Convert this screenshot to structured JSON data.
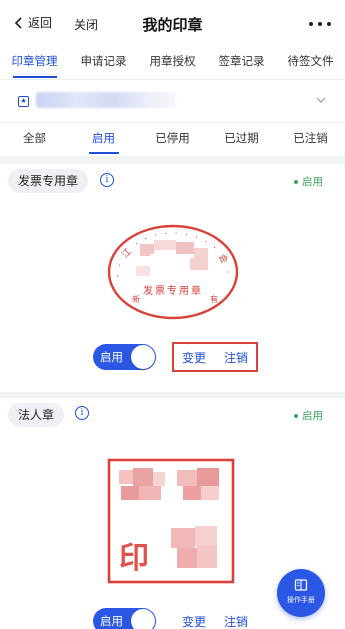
{
  "nav": {
    "back_label": "返回",
    "close_label": "关闭",
    "title": "我的印章"
  },
  "tabs": [
    {
      "label": "印章管理",
      "active": true
    },
    {
      "label": "申请记录",
      "active": false
    },
    {
      "label": "用章授权",
      "active": false
    },
    {
      "label": "签章记录",
      "active": false
    },
    {
      "label": "待签文件",
      "active": false
    }
  ],
  "status_tabs": [
    {
      "label": "全部",
      "active": false
    },
    {
      "label": "启用",
      "active": true
    },
    {
      "label": "已停用",
      "active": false
    },
    {
      "label": "已过期",
      "active": false
    },
    {
      "label": "已注销",
      "active": false
    }
  ],
  "seals": [
    {
      "name": "发票专用章",
      "status": "启用",
      "seal_text": "发票专用章",
      "toggle_label": "启用",
      "enabled": true,
      "actions": [
        "变更",
        "注销"
      ]
    },
    {
      "name": "法人章",
      "status": "启用",
      "seal_text": "印",
      "toggle_label": "启用",
      "enabled": true,
      "actions": [
        "变更",
        "注销"
      ]
    }
  ],
  "fab": {
    "label": "操作手册"
  },
  "colors": {
    "primary": "#2a57e6",
    "link": "#1f4fd8",
    "enabled_status": "#3aa55b",
    "seal_red": "#d9413a",
    "highlight_border": "#d9413a"
  }
}
